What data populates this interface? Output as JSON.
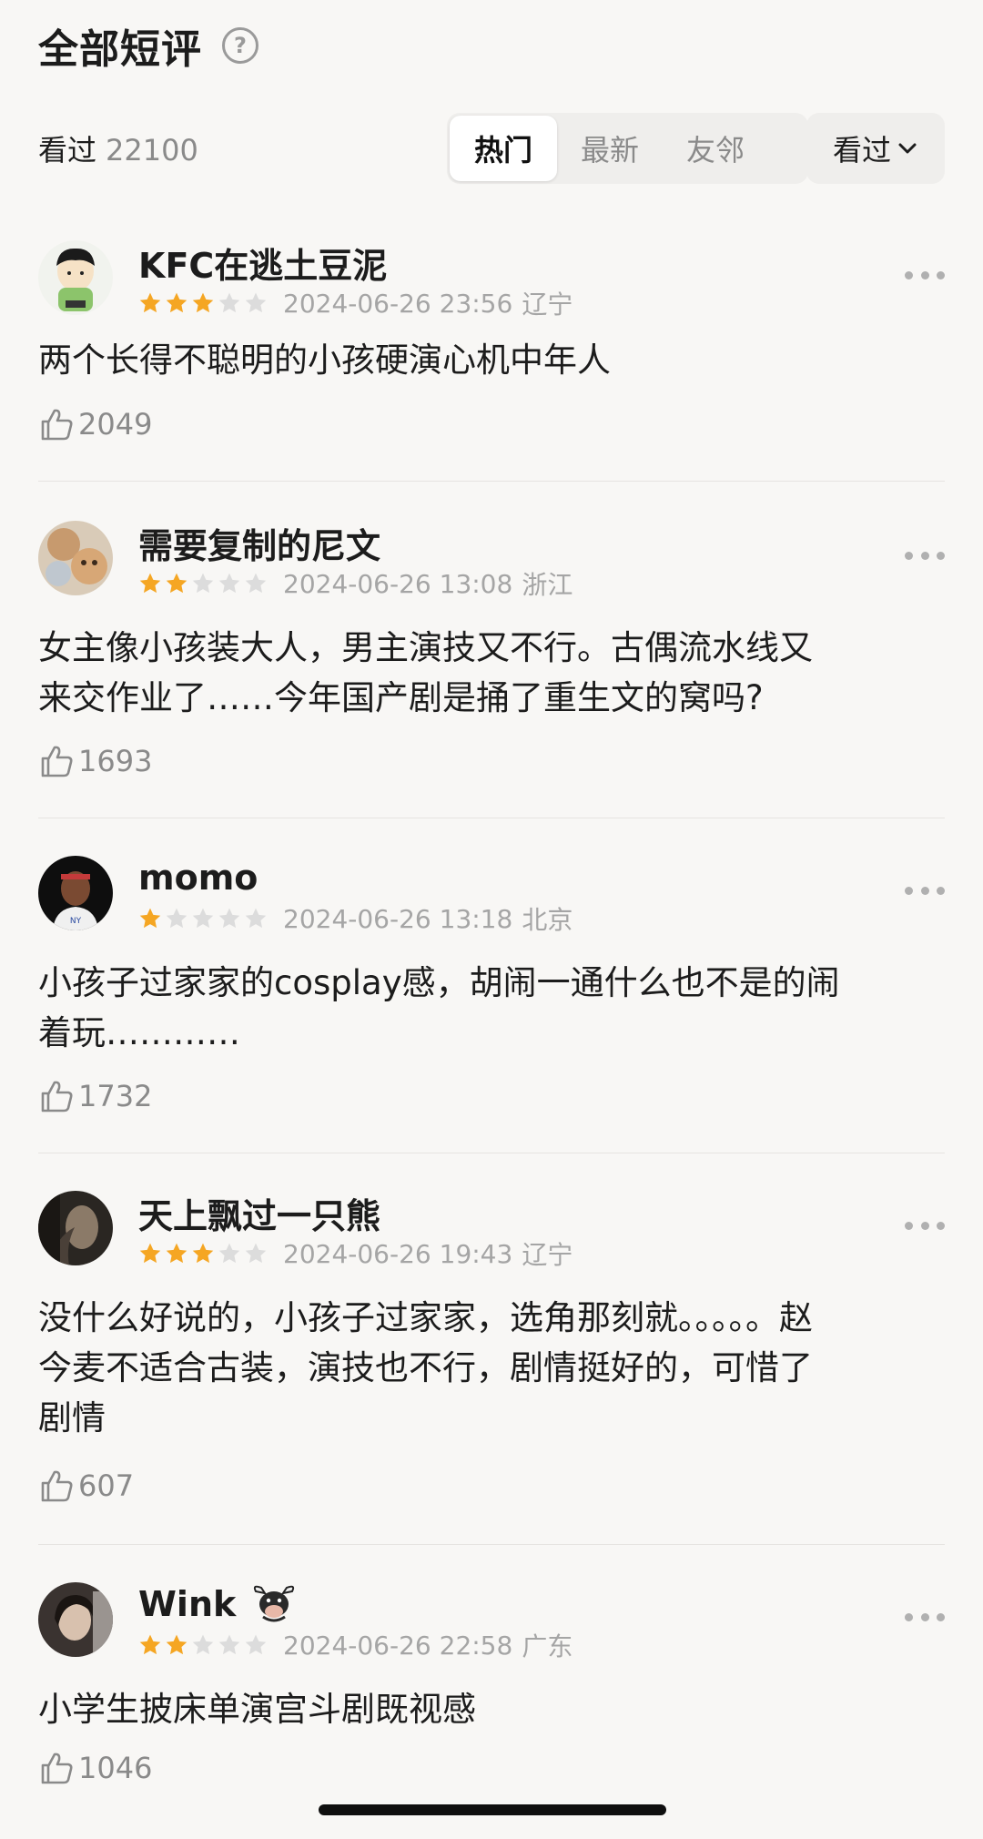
{
  "header": {
    "title": "全部短评",
    "help_icon": "question-circle-icon"
  },
  "filter": {
    "watched_label": "看过",
    "watched_count": "22100",
    "tabs": [
      {
        "label": "热门",
        "active": true
      },
      {
        "label": "最新",
        "active": false
      },
      {
        "label": "友邻",
        "active": false
      }
    ],
    "dropdown_label": "看过",
    "dropdown_icon": "chevron-down-icon"
  },
  "colors": {
    "star_filled": "#f5a623",
    "star_empty": "#dcdcdc",
    "meta_text": "#a5a5a5",
    "background": "#f8f7f5"
  },
  "reviews": [
    {
      "username": "KFC在逃土豆泥",
      "rating": 3,
      "date": "2024-06-26 23:56",
      "location": "辽宁",
      "content": "两个长得不聪明的小孩硬演心机中年人",
      "likes": "2049"
    },
    {
      "username": "需要复制的尼文",
      "rating": 2,
      "date": "2024-06-26 13:08",
      "location": "浙江",
      "content": "女主像小孩装大人，男主演技又不行。古偶流水线又\n来交作业了……今年国产剧是捅了重生文的窝吗?",
      "likes": "1693"
    },
    {
      "username": "momo",
      "rating": 1,
      "date": "2024-06-26 13:18",
      "location": "北京",
      "content": "小孩子过家家的cosplay感，胡闹一通什么也不是的闹\n着玩…………",
      "likes": "1732"
    },
    {
      "username": "天上飘过一只熊",
      "rating": 3,
      "date": "2024-06-26 19:43",
      "location": "辽宁",
      "content": "没什么好说的，小孩子过家家，选角那刻就。。。。。赵\n今麦不适合古装，演技也不行，剧情挺好的，可惜了\n剧情",
      "likes": "607"
    },
    {
      "username": "Wink",
      "rating": 2,
      "date": "2024-06-26 22:58",
      "location": "广东",
      "content": "小学生披床单演宫斗剧既视感",
      "likes": "1046",
      "badge_icon": "ox-emoji-icon"
    }
  ]
}
